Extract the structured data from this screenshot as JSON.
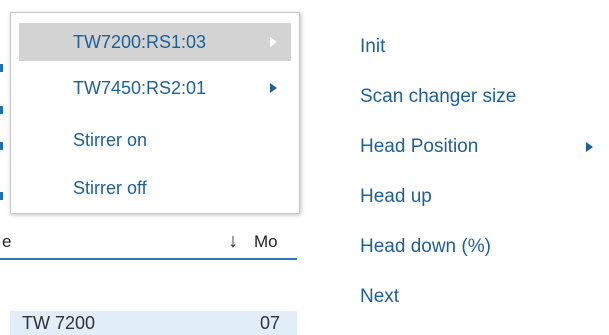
{
  "background": {
    "column_header_partial": "e",
    "column_header_mo": "Mo",
    "sort_icon": "arrow-down-icon",
    "row_partial_name": "TW 7200",
    "row_partial_value": "07"
  },
  "context_menu": {
    "items": [
      {
        "label": "TW7200:RS1:03",
        "has_submenu": true,
        "highlighted": true
      },
      {
        "label": "TW7450:RS2:01",
        "has_submenu": true,
        "highlighted": false
      },
      {
        "label": "Stirrer on",
        "has_submenu": false,
        "highlighted": false
      },
      {
        "label": "Stirrer off",
        "has_submenu": false,
        "highlighted": false
      }
    ]
  },
  "submenu": {
    "items": [
      {
        "label": "Init",
        "has_submenu": false
      },
      {
        "label": "Scan changer size",
        "has_submenu": false
      },
      {
        "label": "Head Position",
        "has_submenu": true
      },
      {
        "label": "Head up",
        "has_submenu": false
      },
      {
        "label": "Head down (%)",
        "has_submenu": false
      },
      {
        "label": "Next",
        "has_submenu": false
      }
    ]
  },
  "colors": {
    "menu_text": "#1d5f99",
    "highlight": "#d3d3d3",
    "accent_line": "#2b78c0",
    "row_background": "#e1eef9"
  }
}
